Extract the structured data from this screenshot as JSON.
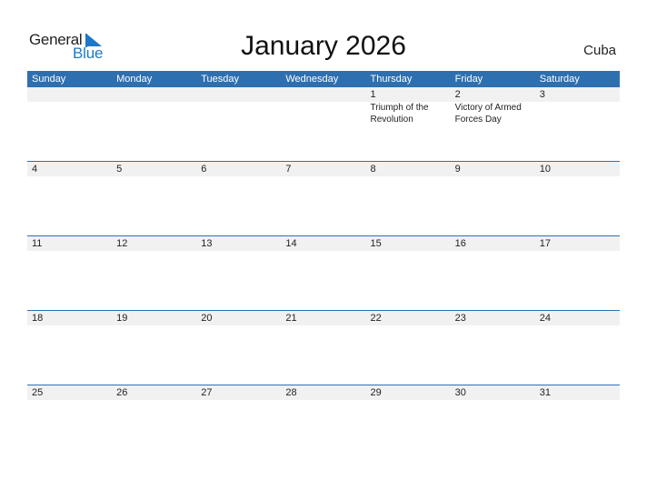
{
  "logo": {
    "general": "General",
    "blue": "Blue"
  },
  "title": "January 2026",
  "country": "Cuba",
  "weekdays": [
    "Sunday",
    "Monday",
    "Tuesday",
    "Wednesday",
    "Thursday",
    "Friday",
    "Saturday"
  ],
  "weeks": [
    {
      "days": [
        "",
        "",
        "",
        "",
        "1",
        "2",
        "3"
      ],
      "holidays": [
        "",
        "",
        "",
        "",
        "Triumph of the Revolution",
        "Victory of Armed Forces Day",
        ""
      ]
    },
    {
      "days": [
        "4",
        "5",
        "6",
        "7",
        "8",
        "9",
        "10"
      ],
      "holidays": [
        "",
        "",
        "",
        "",
        "",
        "",
        ""
      ]
    },
    {
      "days": [
        "11",
        "12",
        "13",
        "14",
        "15",
        "16",
        "17"
      ],
      "holidays": [
        "",
        "",
        "",
        "",
        "",
        "",
        ""
      ]
    },
    {
      "days": [
        "18",
        "19",
        "20",
        "21",
        "22",
        "23",
        "24"
      ],
      "holidays": [
        "",
        "",
        "",
        "",
        "",
        "",
        ""
      ]
    },
    {
      "days": [
        "25",
        "26",
        "27",
        "28",
        "29",
        "30",
        "31"
      ],
      "holidays": [
        "",
        "",
        "",
        "",
        "",
        "",
        ""
      ]
    }
  ],
  "colors": {
    "accent": "#2e6fb0",
    "logo_blue": "#1e78c8",
    "day_bar": "#f1f1f1"
  }
}
